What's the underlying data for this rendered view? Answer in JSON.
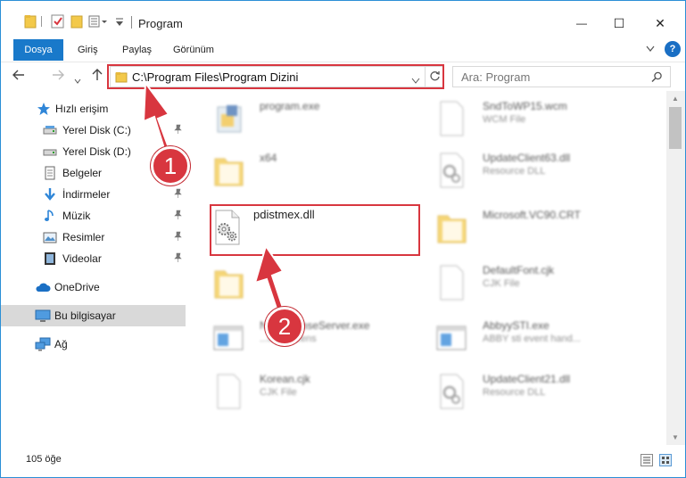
{
  "window": {
    "title": "Program",
    "minimize": "—",
    "maximize": "☐",
    "close": "✕"
  },
  "ribbon": {
    "tabs": [
      "Dosya",
      "Giriş",
      "Paylaş",
      "Görünüm"
    ],
    "help": "?"
  },
  "nav": {
    "address": "C:\\Program Files\\Program Dizini",
    "search_placeholder": "Ara: Program"
  },
  "sidebar": {
    "items": [
      {
        "label": "Hızlı erişim",
        "icon": "star-icon"
      },
      {
        "label": "Yerel Disk (C:)",
        "icon": "drive-icon"
      },
      {
        "label": "Yerel Disk (D:)",
        "icon": "drive-icon"
      },
      {
        "label": "Belgeler",
        "icon": "documents-icon"
      },
      {
        "label": "İndirmeler",
        "icon": "download-icon"
      },
      {
        "label": "Müzik",
        "icon": "music-icon"
      },
      {
        "label": "Resimler",
        "icon": "pictures-icon"
      },
      {
        "label": "Videolar",
        "icon": "videos-icon"
      },
      {
        "label": "OneDrive",
        "icon": "cloud-icon"
      },
      {
        "label": "Bu bilgisayar",
        "icon": "computer-icon"
      },
      {
        "label": "Ağ",
        "icon": "network-icon"
      }
    ]
  },
  "files": [
    {
      "name": "program.exe",
      "sub": "",
      "kind": "exe"
    },
    {
      "name": "SndToWP15.wcm",
      "sub": "WCM File",
      "kind": "doc"
    },
    {
      "name": "x64",
      "sub": "",
      "kind": "folder"
    },
    {
      "name": "UpdateClient63.dll",
      "sub": "Resource DLL",
      "kind": "dll"
    },
    {
      "name": "pdistmex.dll",
      "sub": "",
      "kind": "dll"
    },
    {
      "name": "Microsoft.VC90.CRT",
      "sub": "",
      "kind": "folder"
    },
    {
      "name": "",
      "sub": "",
      "kind": "folder"
    },
    {
      "name": "DefaultFont.cjk",
      "sub": "CJK File",
      "kind": "doc"
    },
    {
      "name": "N...kLicenseServer.exe",
      "sub": "...work licens",
      "kind": "app"
    },
    {
      "name": "AbbyySTI.exe",
      "sub": "ABBY sti event hand...",
      "kind": "app"
    },
    {
      "name": "Korean.cjk",
      "sub": "CJK File",
      "kind": "doc"
    },
    {
      "name": "UpdateClient21.dll",
      "sub": "Resource DLL",
      "kind": "dll"
    }
  ],
  "status": {
    "count": "105 öğe"
  },
  "callouts": [
    "1",
    "2"
  ],
  "colors": {
    "accent": "#1979ca",
    "highlight": "#d8363f"
  }
}
